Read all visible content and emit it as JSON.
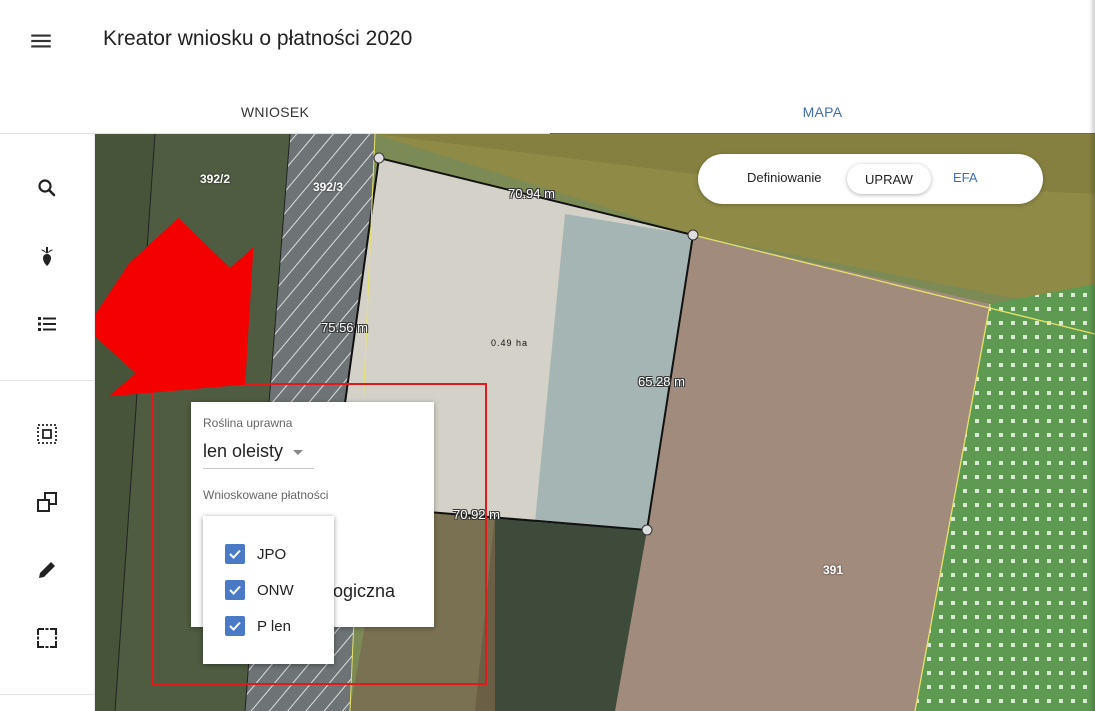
{
  "header": {
    "title": "Kreator wniosku o płatności 2020",
    "menu_icon": "hamburger-menu-icon"
  },
  "tabs": [
    {
      "label": "WNIOSEK",
      "active": false
    },
    {
      "label": "MAPA",
      "active": true
    }
  ],
  "toolbar": {
    "tools": [
      {
        "name": "search-icon"
      },
      {
        "name": "crop-plant-icon"
      },
      {
        "name": "list-icon"
      },
      {
        "name": "select-area-icon"
      },
      {
        "name": "copy-shape-icon"
      },
      {
        "name": "pencil-icon"
      },
      {
        "name": "dashed-rectangle-icon"
      }
    ]
  },
  "map": {
    "parcel_labels": [
      "392/2",
      "392/3",
      "391"
    ],
    "measurements": {
      "top": "70.94 m",
      "left": "75.56 m",
      "right": "65.28 m",
      "bottom": "70.92 m"
    },
    "area": "0.49 ha"
  },
  "mode_switch": {
    "label": "Definiowanie",
    "options": [
      "UPRAW",
      "EFA"
    ],
    "selected": "UPRAW"
  },
  "crop_card": {
    "crop_label": "Roślina uprawna",
    "crop_value": "len oleisty",
    "payments_label": "Wnioskowane płatności",
    "partially_hidden_text": "ologiczna"
  },
  "payments_dropdown": {
    "options": [
      {
        "label": "JPO",
        "checked": true
      },
      {
        "label": "ONW",
        "checked": true
      },
      {
        "label": "P len",
        "checked": true
      }
    ]
  },
  "colors": {
    "accent": "#3f6fb0",
    "checkbox": "#4a7ac6",
    "annotation": "#e11b1b"
  }
}
